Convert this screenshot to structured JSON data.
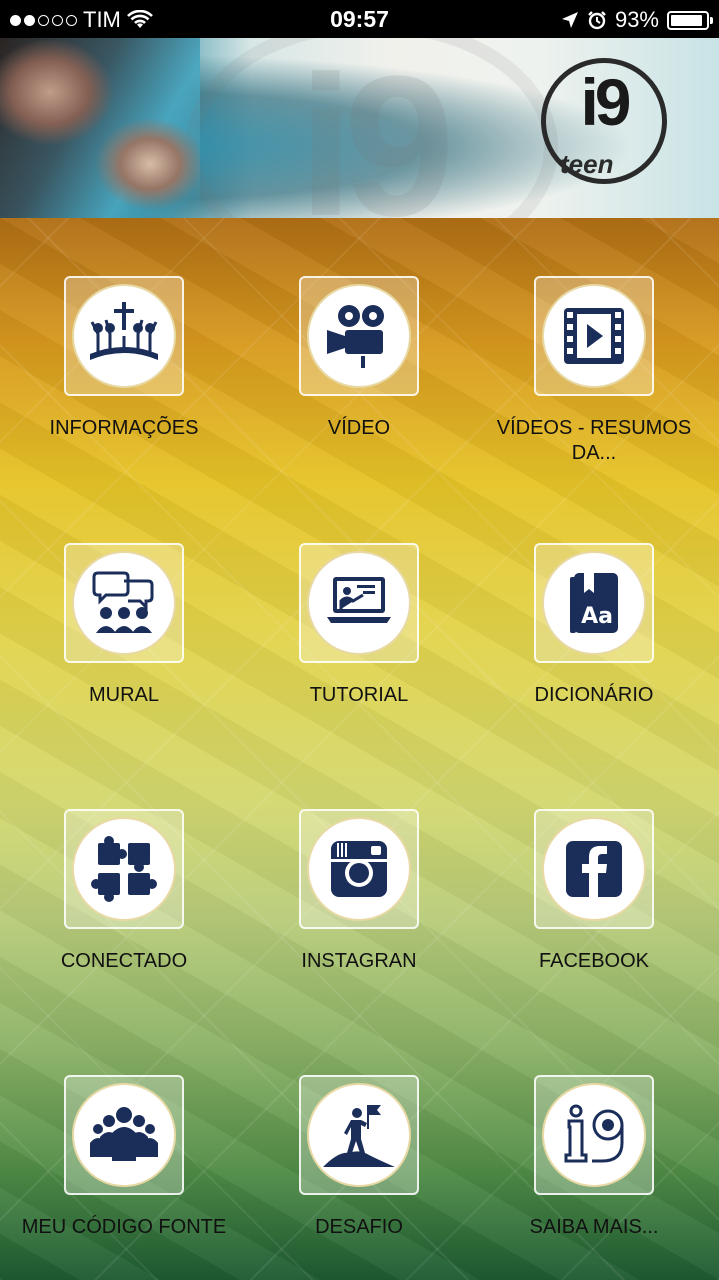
{
  "status_bar": {
    "carrier": "TIM",
    "time": "09:57",
    "battery_percent": "93%",
    "signal_strength": 2,
    "signal_total": 5,
    "battery_level": 0.93
  },
  "banner": {
    "logo_primary": "i9",
    "logo_secondary": "teen"
  },
  "menu": {
    "items": [
      {
        "label": "INFORMAÇÕES",
        "icon": "worship-people-icon"
      },
      {
        "label": "VÍDEO",
        "icon": "film-camera-icon"
      },
      {
        "label": "VÍDEOS - RESUMOS DA...",
        "icon": "film-strip-play-icon"
      },
      {
        "label": "MURAL",
        "icon": "people-chat-icon"
      },
      {
        "label": "TUTORIAL",
        "icon": "laptop-teacher-icon"
      },
      {
        "label": "DICIONÁRIO",
        "icon": "dictionary-book-icon"
      },
      {
        "label": "CONECTADO",
        "icon": "puzzle-pieces-icon"
      },
      {
        "label": "INSTAGRAN",
        "icon": "instagram-icon"
      },
      {
        "label": "FACEBOOK",
        "icon": "facebook-icon"
      },
      {
        "label": "MEU CÓDIGO FONTE",
        "icon": "group-people-icon"
      },
      {
        "label": "DESAFIO",
        "icon": "climber-flag-icon"
      },
      {
        "label": "SAIBA MAIS...",
        "icon": "i9-logo-icon"
      }
    ]
  },
  "colors": {
    "icon_navy": "#1b2e5a"
  }
}
